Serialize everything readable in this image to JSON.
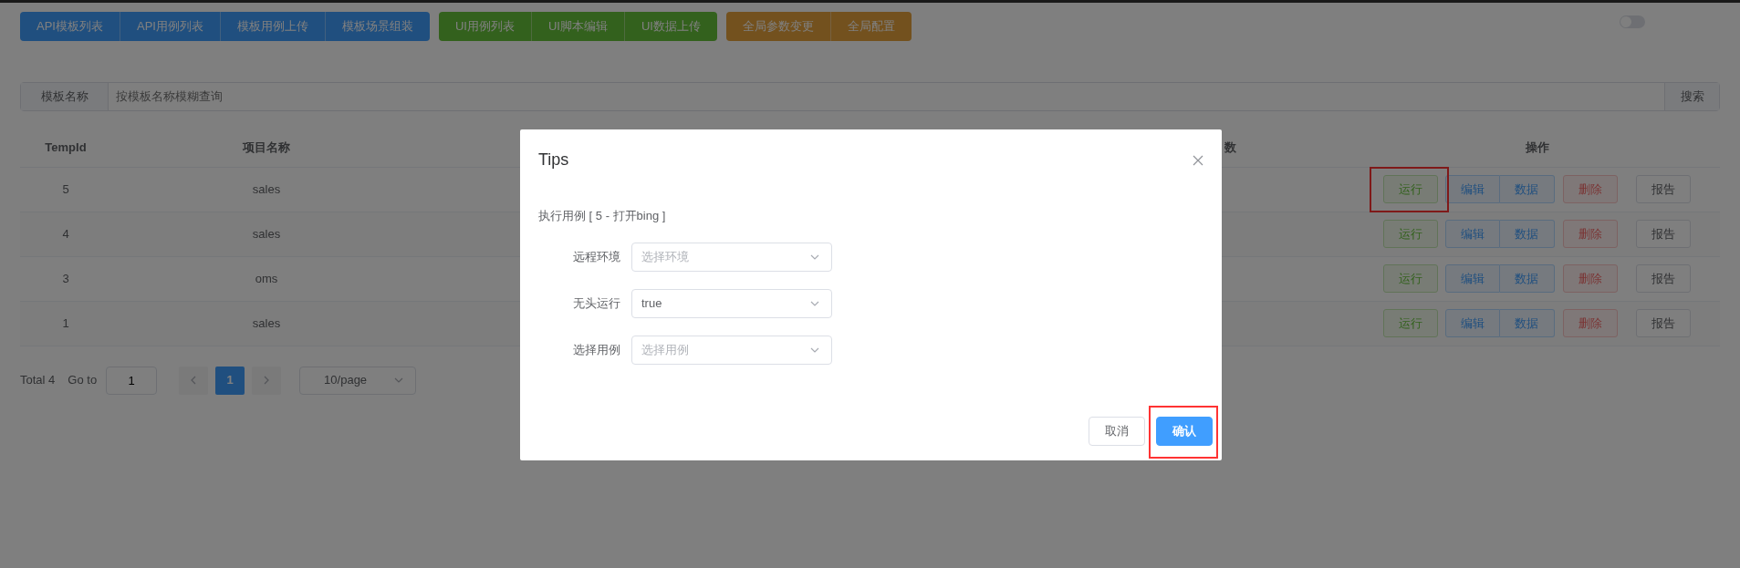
{
  "nav_groups": [
    {
      "kind": "primary",
      "buttons": [
        "API模板列表",
        "API用例列表",
        "模板用例上传",
        "模板场景组装"
      ]
    },
    {
      "kind": "success",
      "buttons": [
        "UI用例列表",
        "UI脚本编辑",
        "UI数据上传"
      ]
    },
    {
      "kind": "warning",
      "buttons": [
        "全局参数变更",
        "全局配置"
      ]
    }
  ],
  "toggle": {
    "on": false
  },
  "search": {
    "label": "模板名称",
    "placeholder": "按模板名称模糊查询",
    "button": "搜索"
  },
  "table": {
    "columns": [
      {
        "label": "TempId"
      },
      {
        "label": "项目名称"
      },
      {
        "label": "数"
      },
      {
        "label": "操作"
      }
    ],
    "rows": [
      {
        "id": "5",
        "project": "sales",
        "highlighted": true,
        "actions": [
          {
            "kind": "run",
            "label": "运行"
          },
          {
            "kind": "edit",
            "label": "编辑"
          },
          {
            "kind": "data",
            "label": "数据"
          },
          {
            "kind": "delete",
            "label": "删除"
          },
          {
            "kind": "report",
            "label": "报告"
          }
        ]
      },
      {
        "id": "4",
        "project": "sales",
        "highlighted": false,
        "actions": [
          {
            "kind": "run",
            "label": "运行"
          },
          {
            "kind": "edit",
            "label": "编辑"
          },
          {
            "kind": "data",
            "label": "数据"
          },
          {
            "kind": "delete",
            "label": "删除"
          },
          {
            "kind": "report",
            "label": "报告"
          }
        ]
      },
      {
        "id": "3",
        "project": "oms",
        "highlighted": false,
        "actions": [
          {
            "kind": "run",
            "label": "运行"
          },
          {
            "kind": "edit",
            "label": "编辑"
          },
          {
            "kind": "data",
            "label": "数据"
          },
          {
            "kind": "delete",
            "label": "删除"
          },
          {
            "kind": "report",
            "label": "报告"
          }
        ]
      },
      {
        "id": "1",
        "project": "sales",
        "highlighted": false,
        "actions": [
          {
            "kind": "run",
            "label": "运行"
          },
          {
            "kind": "edit",
            "label": "编辑"
          },
          {
            "kind": "data",
            "label": "数据"
          },
          {
            "kind": "delete",
            "label": "删除"
          },
          {
            "kind": "report",
            "label": "报告"
          }
        ]
      }
    ]
  },
  "pagination": {
    "total": "Total 4",
    "goto_label": "Go to",
    "goto_value": "1",
    "pages": [
      {
        "label": "1",
        "selected": true
      }
    ],
    "page_size": "10/page"
  },
  "modal": {
    "title": "Tips",
    "description": "执行用例 [ 5 - 打开bing ]",
    "fields": [
      {
        "label": "远程环境",
        "placeholder": "选择环境"
      },
      {
        "label": "无头运行",
        "value": "true"
      },
      {
        "label": "选择用例",
        "placeholder": "选择用例"
      }
    ],
    "buttons": [
      {
        "kind": "cancel",
        "label": "取消",
        "highlighted": false
      },
      {
        "kind": "confirm",
        "label": "确认",
        "highlighted": true
      }
    ]
  }
}
